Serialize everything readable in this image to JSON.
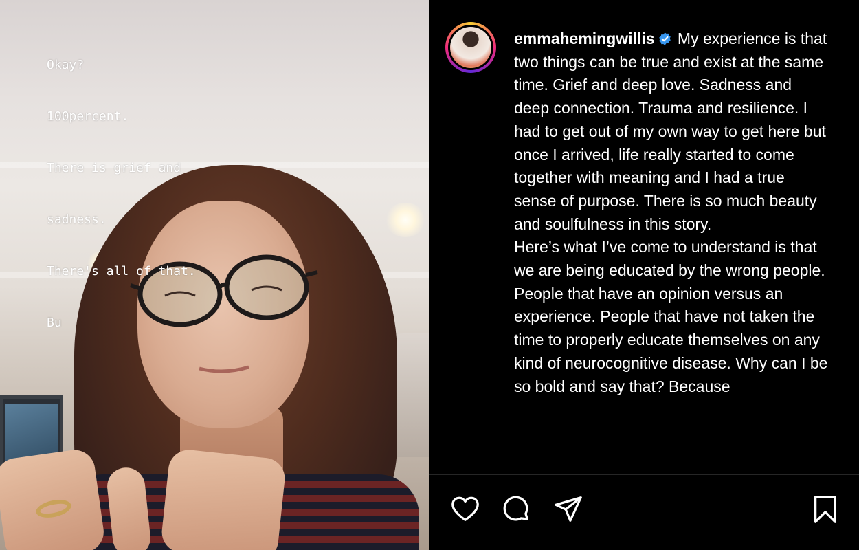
{
  "story": {
    "overlay_lines": [
      "Okay?",
      "100percent.",
      "There is grief and",
      "sadness.",
      "There's all of that.",
      "Bu"
    ]
  },
  "post": {
    "username": "emmahemingwillis",
    "verified": true,
    "caption_paragraph_1": "My experience is that two things can be true and exist at the same time. Grief and deep love. Sadness and deep connection. Trauma and resilience. I had to get out of my own way to get here but once I arrived, life really started to come together with meaning and I had a true sense of purpose. There is so much beauty and soulfulness in this story.",
    "caption_paragraph_2": "Here’s what I’ve come to understand is that we are being educated by the wrong people. People that have an opinion versus an experience. People that have not taken the time to properly educate themselves on any kind of neurocognitive disease. Why can I be so bold and say that? Because"
  },
  "actions": {
    "icons": [
      "heart-icon",
      "comment-icon",
      "share-icon",
      "bookmark-icon"
    ]
  },
  "colors": {
    "panel_background": "#000000",
    "text": "#ffffff",
    "verified_badge": "#3897f0",
    "divider": "#262626"
  }
}
